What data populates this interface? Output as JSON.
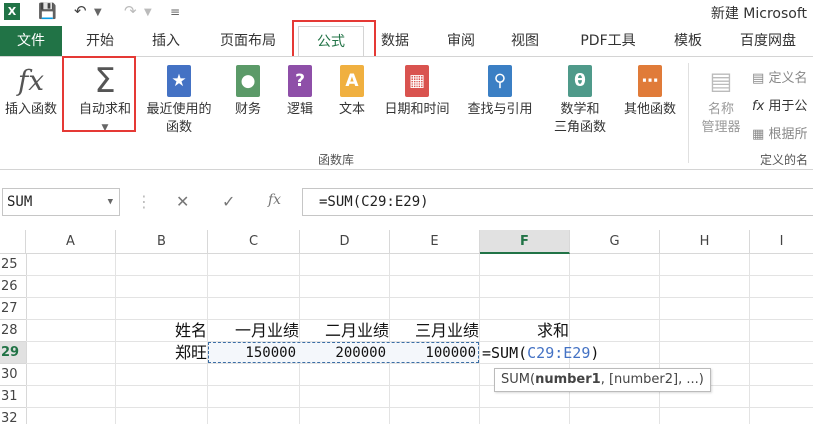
{
  "app": {
    "title": "新建 Microsoft",
    "logo": "X"
  },
  "tabs": [
    "文件",
    "开始",
    "插入",
    "页面布局",
    "公式",
    "数据",
    "审阅",
    "视图",
    "PDF工具",
    "模板",
    "百度网盘"
  ],
  "ribbon": {
    "insert_function": "插入函数",
    "autosum_line1": "自动求和",
    "recent_line1": "最近使用的",
    "recent_line2": "函数",
    "financial": "财务",
    "logical": "逻辑",
    "text": "文本",
    "datetime": "日期和时间",
    "lookup": "查找与引用",
    "math_line1": "数学和",
    "math_line2": "三角函数",
    "more": "其他函数",
    "name_mgr_line1": "名称",
    "name_mgr_line2": "管理器",
    "define_name": "定义名",
    "use_in_formula": "用于公",
    "create_from_sel": "根据所",
    "group_library": "函数库",
    "group_defined": "定义的名"
  },
  "formula_bar": {
    "name_box": "SUM",
    "formula": "=SUM(C29:E29)"
  },
  "columns": [
    "A",
    "B",
    "C",
    "D",
    "E",
    "F",
    "G",
    "H",
    "I"
  ],
  "rows": [
    "25",
    "26",
    "27",
    "28",
    "29",
    "30",
    "31",
    "32"
  ],
  "cells": {
    "b28": "姓名",
    "c28": "一月业绩",
    "d28": "二月业绩",
    "e28": "三月业绩",
    "f28": "求和",
    "b29": "郑旺",
    "c29": "150000",
    "d29": "200000",
    "e29": "100000",
    "f29_prefix": "=SUM(",
    "f29_ref": "C29:E29",
    "f29_suffix": ")"
  },
  "tooltip": {
    "func": "SUM(",
    "arg1": "number1",
    "rest": ", [number2], ...)"
  },
  "colors": {
    "excel_green": "#217346",
    "highlight_red": "#e53935",
    "ref_blue": "#4472c4"
  }
}
